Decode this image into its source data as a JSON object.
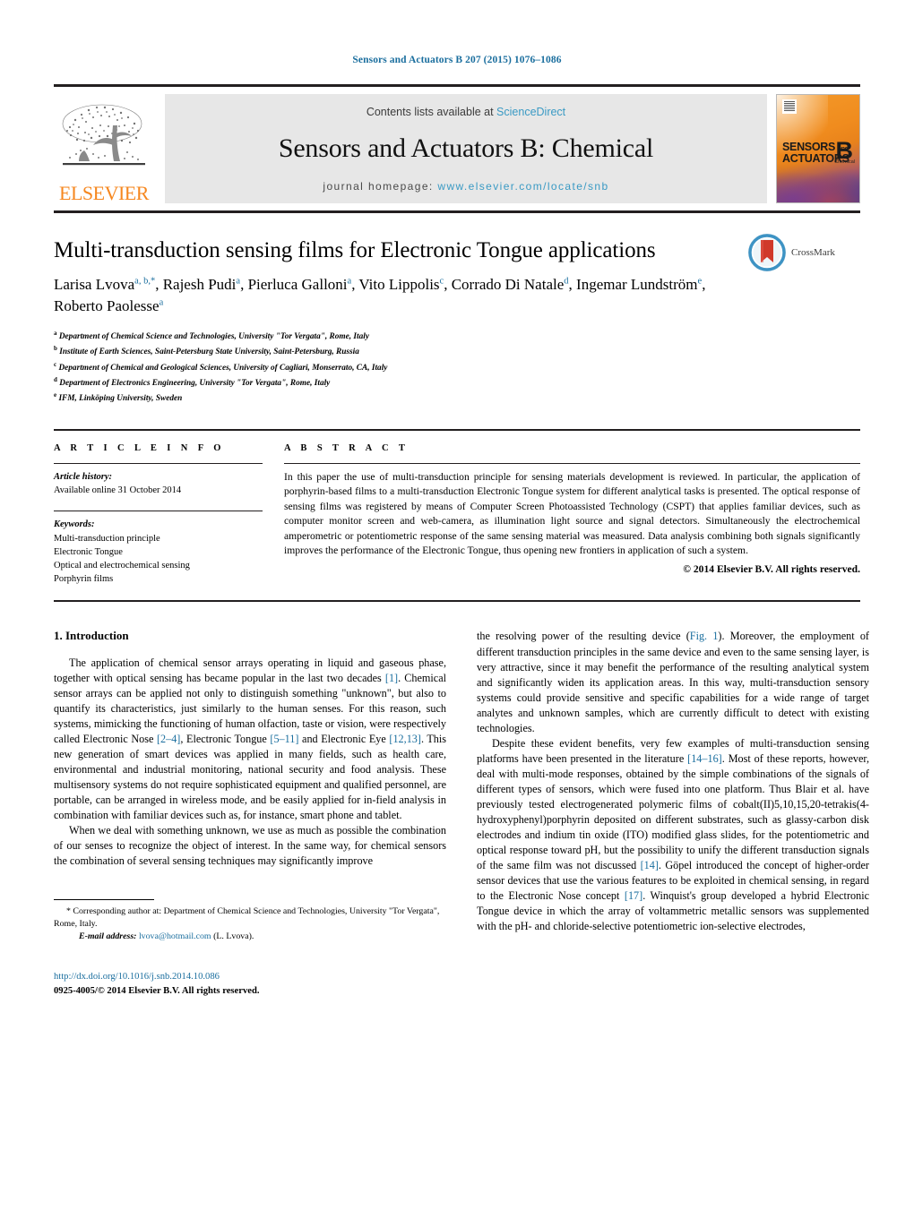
{
  "running_head": "Sensors and Actuators B 207 (2015) 1076–1086",
  "masthead": {
    "publisher_name": "ELSEVIER",
    "contents_prefix": "Contents lists available at ",
    "contents_link": "ScienceDirect",
    "journal_title": "Sensors and Actuators B: Chemical",
    "homepage_prefix": "journal homepage:",
    "homepage_url": "www.elsevier.com/locate/snb",
    "cover": {
      "line1": "SENSORS",
      "and": "and",
      "line2": "ACTUATORS",
      "letter": "B",
      "letter_sub": "Chemical"
    }
  },
  "article": {
    "title": "Multi-transduction sensing films for Electronic Tongue applications",
    "authors": [
      {
        "name": "Larisa Lvova",
        "sup": "a, b,",
        "star": "*"
      },
      {
        "name": "Rajesh Pudi",
        "sup": "a"
      },
      {
        "name": "Pierluca Galloni",
        "sup": "a"
      },
      {
        "name": "Vito Lippolis",
        "sup": "c"
      },
      {
        "name": "Corrado Di Natale",
        "sup": "d"
      },
      {
        "name": "Ingemar Lundström",
        "sup": "e"
      },
      {
        "name": "Roberto Paolesse",
        "sup": "a"
      }
    ],
    "affiliations": [
      {
        "mark": "a",
        "text": "Department of Chemical Science and Technologies, University \"Tor Vergata\", Rome, Italy"
      },
      {
        "mark": "b",
        "text": "Institute of Earth Sciences, Saint-Petersburg State University, Saint-Petersburg, Russia"
      },
      {
        "mark": "c",
        "text": "Department of Chemical and Geological Sciences, University of Cagliari, Monserrato, CA, Italy"
      },
      {
        "mark": "d",
        "text": "Department of Electronics Engineering, University \"Tor Vergata\", Rome, Italy"
      },
      {
        "mark": "e",
        "text": "IFM, Linköping University, Sweden"
      }
    ],
    "crossmark_label": "CrossMark"
  },
  "article_info": {
    "heading": "A R T I C L E   I N F O",
    "history_label": "Article history:",
    "history_value": "Available online 31 October 2014",
    "keywords_label": "Keywords:",
    "keywords": [
      "Multi-transduction principle",
      "Electronic Tongue",
      "Optical and electrochemical sensing",
      "Porphyrin films"
    ]
  },
  "abstract": {
    "heading": "A B S T R A C T",
    "text": "In this paper the use of multi-transduction principle for sensing materials development is reviewed. In particular, the application of porphyrin-based films to a multi-transduction Electronic Tongue system for different analytical tasks is presented. The optical response of sensing films was registered by means of Computer Screen Photoassisted Technology (CSPT) that applies familiar devices, such as computer monitor screen and web-camera, as illumination light source and signal detectors. Simultaneously the electrochemical amperometric or potentiometric response of the same sensing material was measured. Data analysis combining both signals significantly improves the performance of the Electronic Tongue, thus opening new frontiers in application of such a system.",
    "copyright": "© 2014 Elsevier B.V. All rights reserved."
  },
  "body": {
    "section_number_title": "1.  Introduction",
    "left_paragraphs": [
      "The application of chemical sensor arrays operating in liquid and gaseous phase, together with optical sensing has became popular in the last two decades [1]. Chemical sensor arrays can be applied not only to distinguish something \"unknown\", but also to quantify its characteristics, just similarly to the human senses. For this reason, such systems, mimicking the functioning of human olfaction, taste or vision, were respectively called Electronic Nose [2–4], Electronic Tongue [5–11] and Electronic Eye [12,13]. This new generation of smart devices was applied in many fields, such as health care, environmental and industrial monitoring, national security and food analysis. These multisensory systems do not require sophisticated equipment and qualified personnel, are portable, can be arranged in wireless mode, and be easily applied for in-field analysis in combination with familiar devices such as, for instance, smart phone and tablet.",
      "When we deal with something unknown, we use as much as possible the combination of our senses to recognize the object of interest. In the same way, for chemical sensors the combination of several sensing techniques may significantly improve"
    ],
    "right_paragraphs": [
      "the resolving power of the resulting device (Fig. 1). Moreover, the employment of different transduction principles in the same device and even to the same sensing layer, is very attractive, since it may benefit the performance of the resulting analytical system and significantly widen its application areas. In this way, multi-transduction sensory systems could provide sensitive and specific capabilities for a wide range of target analytes and unknown samples, which are currently difficult to detect with existing technologies.",
      "Despite these evident benefits, very few examples of multi-transduction sensing platforms have been presented in the literature [14–16]. Most of these reports, however, deal with multi-mode responses, obtained by the simple combinations of the signals of different types of sensors, which were fused into one platform. Thus Blair et al. have previously tested electrogenerated polymeric films of cobalt(II)5,10,15,20-tetrakis(4-hydroxyphenyl)porphyrin deposited on different substrates, such as glassy-carbon disk electrodes and indium tin oxide (ITO) modified glass slides, for the potentiometric and optical response toward pH, but the possibility to unify the different transduction signals of the same film was not discussed [14]. Göpel introduced the concept of higher-order sensor devices that use the various features to be exploited in chemical sensing, in regard to the Electronic Nose concept [17]. Winquist's group developed a hybrid Electronic Tongue device in which the array of voltammetric metallic sensors was supplemented with the pH- and chloride-selective potentiometric ion-selective electrodes,"
    ]
  },
  "footer": {
    "corresponding_marker": "*",
    "corresponding_text": "Corresponding author at: Department of Chemical Science and Technologies, University \"Tor Vergata\", Rome, Italy.",
    "email_label": "E-mail address:",
    "email": "lvova@hotmail.com",
    "email_owner": "(L. Lvova).",
    "doi": "http://dx.doi.org/10.1016/j.snb.2014.10.086",
    "issn_line": "0925-4005/© 2014 Elsevier B.V. All rights reserved."
  },
  "colors": {
    "link_blue": "#1a6e9e",
    "science_direct_blue": "#3a9ac4",
    "elsevier_orange": "#f6871f",
    "band_gray": "#e7e7e7"
  }
}
